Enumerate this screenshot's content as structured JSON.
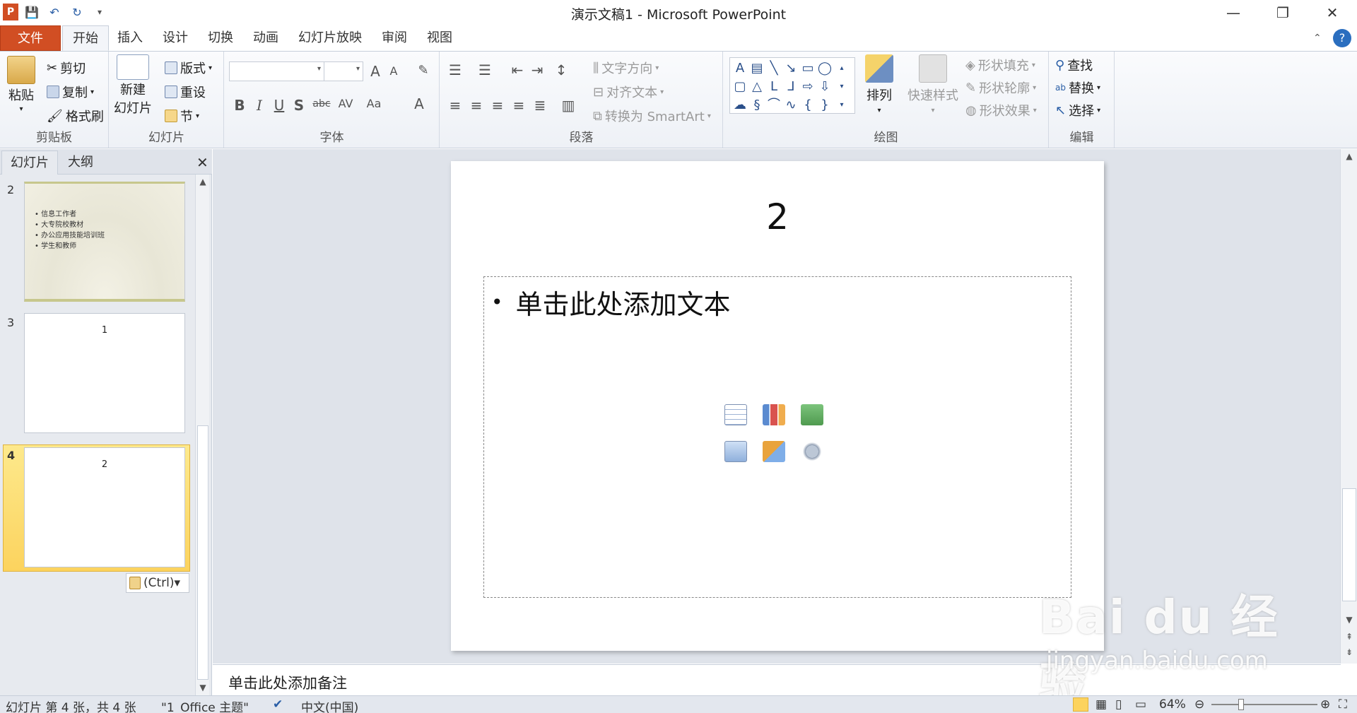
{
  "window": {
    "title": "演示文稿1 - Microsoft PowerPoint",
    "minimize": "—",
    "restore": "❐",
    "close": "✕"
  },
  "qat": {
    "save": "💾",
    "undo": "↶",
    "redo": "↻"
  },
  "tabs": [
    {
      "label": "文件"
    },
    {
      "label": "开始"
    },
    {
      "label": "插入"
    },
    {
      "label": "设计"
    },
    {
      "label": "切换"
    },
    {
      "label": "动画"
    },
    {
      "label": "幻灯片放映"
    },
    {
      "label": "审阅"
    },
    {
      "label": "视图"
    }
  ],
  "ribbon": {
    "clipboard": {
      "label": "剪贴板",
      "paste": "粘贴",
      "cut": "剪切",
      "copy": "复制",
      "format_painter": "格式刷"
    },
    "slides": {
      "label": "幻灯片",
      "new_slide_1": "新建",
      "new_slide_2": "幻灯片",
      "layout": "版式",
      "reset": "重设",
      "section": "节"
    },
    "font": {
      "label": "字体",
      "bold": "B",
      "italic": "I",
      "underline": "U",
      "shadow": "S",
      "strike": "abc",
      "spacing": "AV",
      "case": "Aa",
      "grow": "A",
      "shrink": "A",
      "color": "A"
    },
    "paragraph": {
      "label": "段落",
      "text_direction": "文字方向",
      "align_text": "对齐文本",
      "smartart": "转换为 SmartArt"
    },
    "drawing": {
      "label": "绘图",
      "arrange": "排列",
      "quick_styles": "快速样式",
      "shape_fill": "形状填充",
      "shape_outline": "形状轮廓",
      "shape_effects": "形状效果"
    },
    "editing": {
      "label": "编辑",
      "find": "查找",
      "replace": "替换",
      "select": "选择"
    }
  },
  "pane": {
    "tab_slides": "幻灯片",
    "tab_outline": "大纲",
    "close": "✕",
    "slides": [
      {
        "num": "2",
        "bullets": [
          "信息工作者",
          "大专院校教材",
          "办公应用技能培训班",
          "学生和教师"
        ]
      },
      {
        "num": "3",
        "title": "1"
      },
      {
        "num": "4",
        "title": "2"
      }
    ],
    "paste_options": "(Ctrl)▾"
  },
  "slide": {
    "title": "2",
    "body_placeholder": "单击此处添加文本",
    "bullet": "•"
  },
  "notes": {
    "placeholder": "单击此处添加备注"
  },
  "status": {
    "slide_info": "幻灯片 第 4 张，共 4 张",
    "theme": "\"1_Office 主题\"",
    "language": "中文(中国)",
    "zoom": "64%"
  },
  "watermark": {
    "logo": "Bai du 经验",
    "url": "jingyan.baidu.com"
  },
  "colors": {
    "file_tab": "#d14e23",
    "selection": "#fcd35e",
    "ribbon_bg": "#eef1f6"
  }
}
